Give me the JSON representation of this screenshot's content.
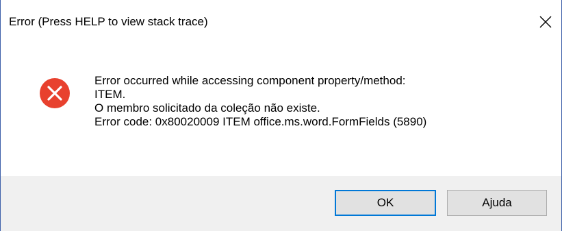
{
  "window": {
    "title": "Error (Press HELP to view stack trace)",
    "close_icon": "close-icon"
  },
  "message": {
    "icon": "error-icon",
    "lines": [
      "Error occurred while accessing component property/method:",
      "ITEM.",
      "O membro solicitado da coleção não existe.",
      "Error code: 0x80020009 ITEM office.ms.word.FormFields (5890)"
    ]
  },
  "buttons": {
    "ok_label": "OK",
    "help_label": "Ajuda"
  },
  "colors": {
    "error_red": "#e81123",
    "accent": "#0078d7"
  }
}
